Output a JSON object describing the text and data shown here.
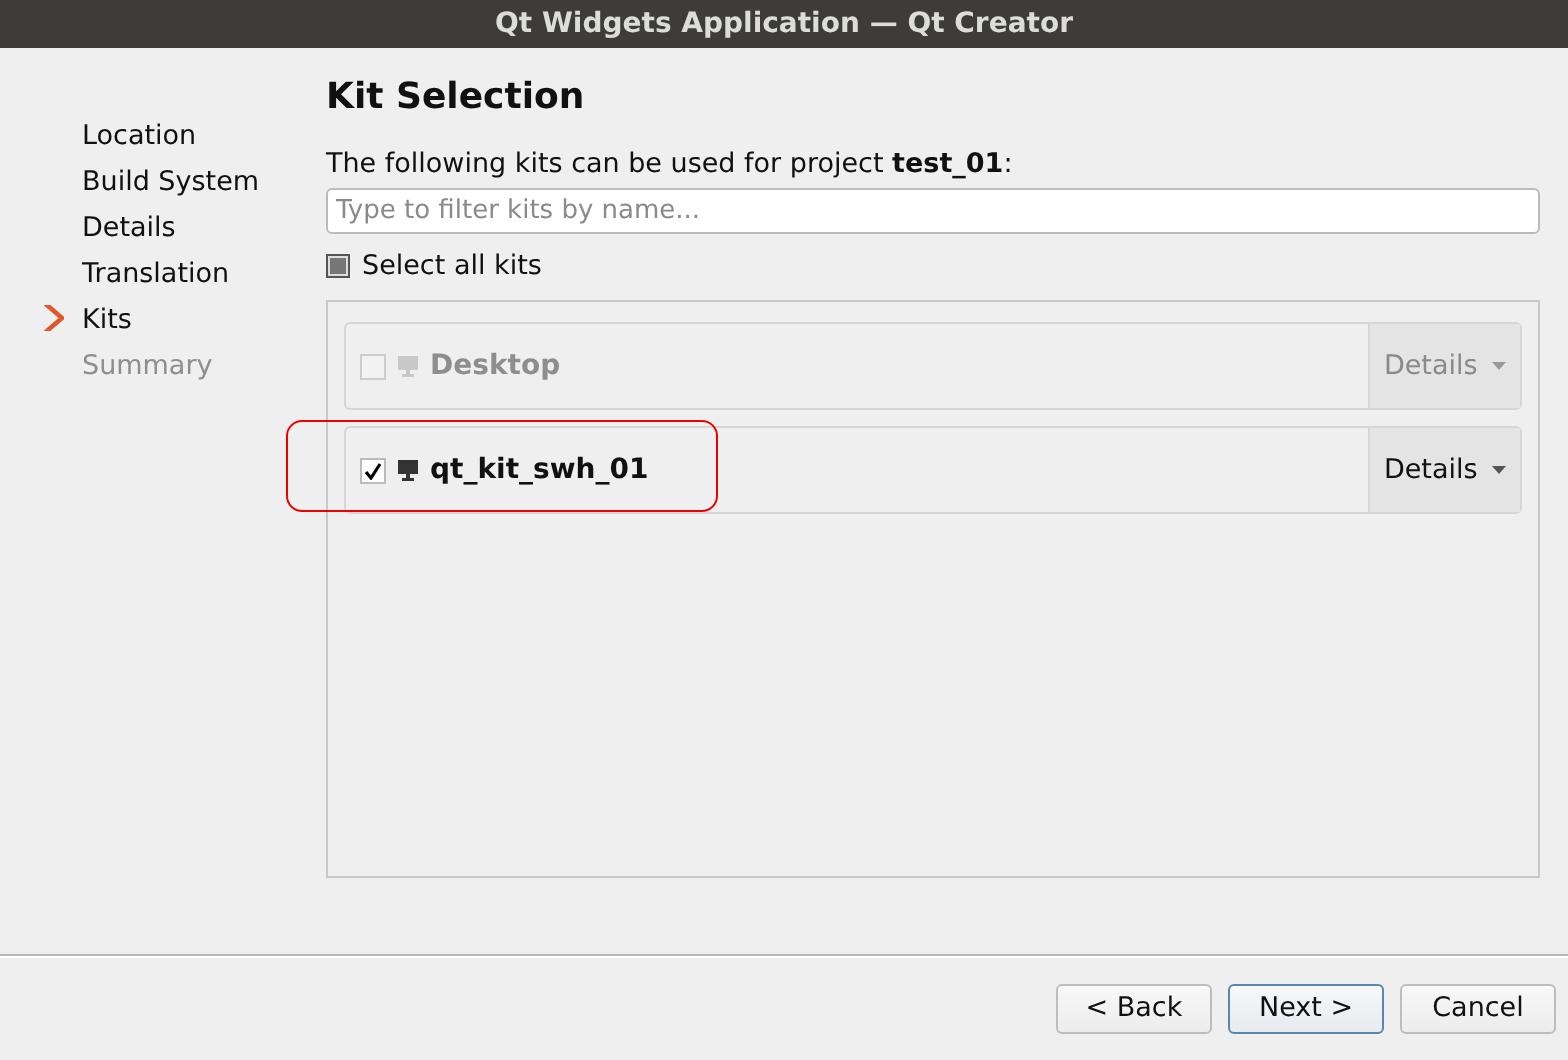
{
  "window": {
    "title": "Qt Widgets Application — Qt Creator"
  },
  "sidebar": {
    "items": [
      {
        "label": "Location",
        "selected": false,
        "disabled": false
      },
      {
        "label": "Build System",
        "selected": false,
        "disabled": false
      },
      {
        "label": "Details",
        "selected": false,
        "disabled": false
      },
      {
        "label": "Translation",
        "selected": false,
        "disabled": false
      },
      {
        "label": "Kits",
        "selected": true,
        "disabled": false
      },
      {
        "label": "Summary",
        "selected": false,
        "disabled": true
      }
    ]
  },
  "page": {
    "title": "Kit Selection",
    "description": "The following kits can be used for project **test_01**:",
    "filter": {
      "placeholder": "Type to filter kits by name..."
    },
    "select_all": {
      "label": "Select all kits",
      "checked": false,
      "partial": true
    }
  },
  "kits": [
    {
      "name": "Desktop",
      "checked": false,
      "disabled": true,
      "highlighted": false,
      "details": "Details"
    },
    {
      "name": "qt_kit_swh_01",
      "checked": true,
      "disabled": false,
      "highlighted": true,
      "details": "Details"
    }
  ],
  "buttons": [
    {
      "label": "< Back",
      "default": false
    },
    {
      "label": "Next >",
      "default": true
    },
    {
      "label": "Cancel",
      "default": false
    }
  ]
}
